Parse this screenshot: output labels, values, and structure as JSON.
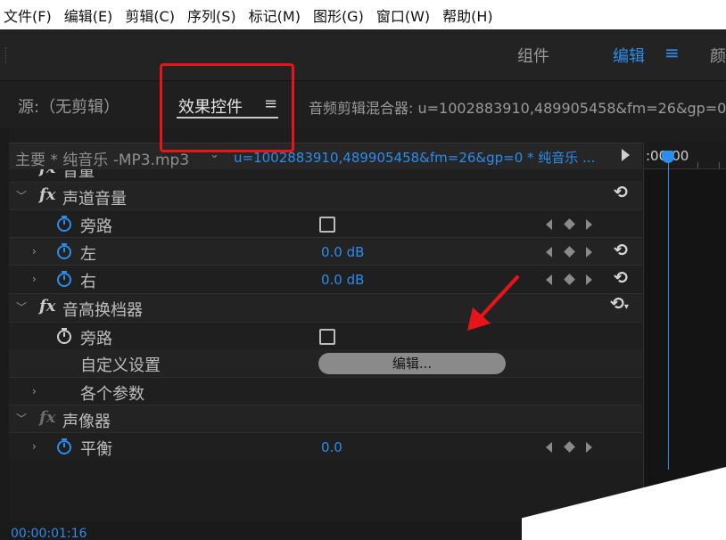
{
  "menu": [
    "文件(F)",
    "编辑(E)",
    "剪辑(C)",
    "序列(S)",
    "标记(M)",
    "图形(G)",
    "窗口(W)",
    "帮助(H)"
  ],
  "workspaces": {
    "assembly": "组件",
    "edit": "编辑",
    "color": "颜"
  },
  "tabs": {
    "source": "源:（无剪辑）",
    "effect_controls": "效果控件",
    "mixer": "音频剪辑混合器: u=1002883910,489905458&fm=26&gp=0"
  },
  "clip": {
    "main": "主要 * 纯音乐 -MP3.mp3",
    "sequence": "u=1002883910,489905458&fm=26&gp=0 * 纯音乐 ..."
  },
  "timeline": {
    "time": ":00:00"
  },
  "effects": {
    "volume_partial": "音量",
    "channel_volume": {
      "title": "声道音量",
      "bypass": "旁路",
      "left": {
        "label": "左",
        "value": "0.0 dB"
      },
      "right": {
        "label": "右",
        "value": "0.0 dB"
      }
    },
    "pitch_shifter": {
      "title": "音高换档器",
      "bypass": "旁路",
      "custom_setup": "自定义设置",
      "edit_button": "编辑...",
      "params": "各个参数"
    },
    "panner": {
      "title": "声像器",
      "balance": {
        "label": "平衡",
        "value": "0.0"
      }
    }
  },
  "timecode": "00:00:01:16",
  "colors": {
    "accent": "#2d8ceb",
    "highlight_box": "#e8141a"
  }
}
